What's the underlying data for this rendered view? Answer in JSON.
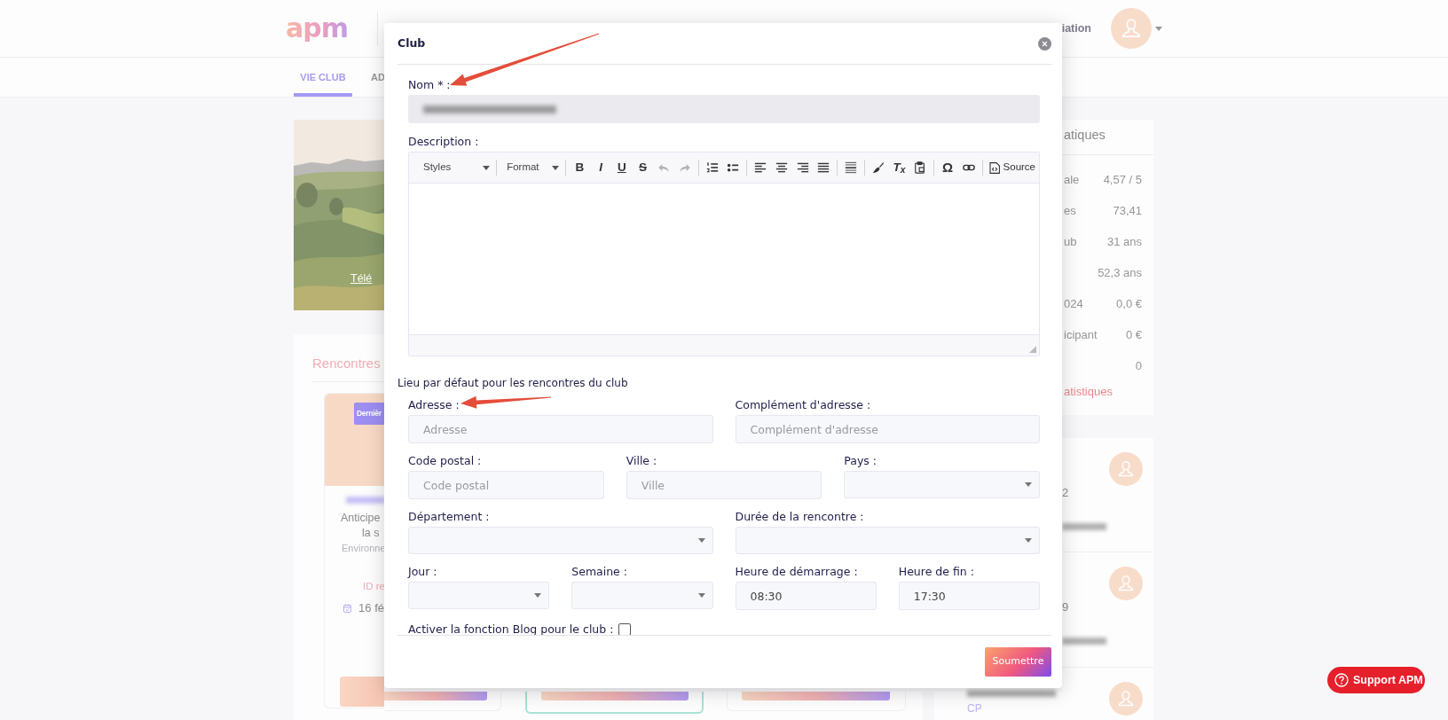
{
  "header": {
    "logo": "apm",
    "account_label": "iation"
  },
  "tabs": [
    {
      "label": "VIE CLUB",
      "selected": true
    },
    {
      "label": "AD",
      "selected": false
    }
  ],
  "club_photo": {
    "link": "Télé"
  },
  "meetings": {
    "title": "Rencontres",
    "card": {
      "badge": "Dernièr",
      "title_lines": [
        "Anticipe",
        "la s"
      ],
      "subtitle": "Environne",
      "id_label": "ID re",
      "date": "16 fé"
    }
  },
  "stats": {
    "title": "atiques",
    "rows": [
      {
        "label": "ale",
        "value": "4,57 / 5"
      },
      {
        "label": "es",
        "value": "73,41"
      },
      {
        "label": "ub",
        "value": "31 ans"
      },
      {
        "value": "52,3 ans"
      },
      {
        "label": "024",
        "value": "0,0 €"
      },
      {
        "label": "icipant",
        "value": "0 €"
      },
      {
        "value": "0"
      }
    ],
    "link": "atistiques"
  },
  "members": [
    {
      "line": "2"
    },
    {
      "line": "9"
    },
    {
      "line": "CP"
    }
  ],
  "modal": {
    "title": "Club",
    "name_field": {
      "label": "Nom * :",
      "redacted": true
    },
    "description": {
      "label": "Description :",
      "toolbar": {
        "styles": "Styles",
        "format": "Format",
        "bold": "B",
        "italic": "I",
        "underline": "U",
        "strike": "S",
        "undo_disabled": true,
        "redo_disabled": true,
        "clear_format": "T$_{x}$",
        "special_char": "Ω",
        "source": "Source"
      }
    },
    "section_title": "Lieu par défaut pour les rencontres du club",
    "rows": [
      {
        "fields": [
          {
            "kind": "text",
            "label": "Adresse :",
            "placeholder": "Adresse"
          },
          {
            "kind": "text",
            "label": "Complément d'adresse :",
            "placeholder": "Complément d'adresse"
          }
        ]
      },
      {
        "fields": [
          {
            "kind": "text",
            "label": "Code postal :",
            "placeholder": "Code postal"
          },
          {
            "kind": "text",
            "label": "Ville :",
            "placeholder": "Ville"
          },
          {
            "kind": "select",
            "label": "Pays :"
          }
        ]
      },
      {
        "fields": [
          {
            "kind": "select",
            "label": "Département :"
          },
          {
            "kind": "select",
            "label": "Durée de la rencontre :"
          }
        ]
      },
      {
        "fields": [
          {
            "kind": "select",
            "label": "Jour :"
          },
          {
            "kind": "select",
            "label": "Semaine :"
          },
          {
            "kind": "text",
            "label": "Heure de démarrage :",
            "value": "08:30"
          },
          {
            "kind": "text",
            "label": "Heure de fin :",
            "value": "17:30"
          }
        ]
      }
    ],
    "blog": {
      "label": "Activer la fonction Blog pour le club :",
      "checked": false
    },
    "submit": "Soumettre"
  },
  "support_button": {
    "label": "Support APM"
  }
}
